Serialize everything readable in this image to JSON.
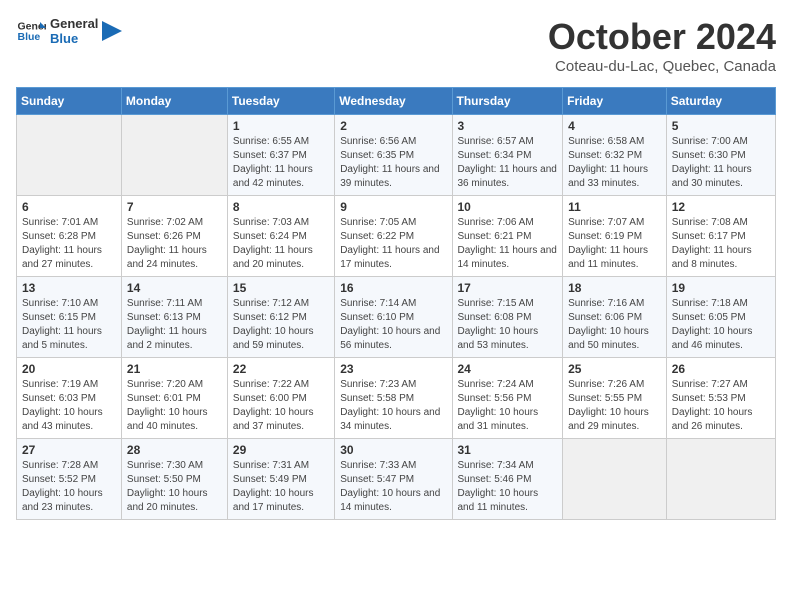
{
  "header": {
    "logo_line1": "General",
    "logo_line2": "Blue",
    "month_title": "October 2024",
    "subtitle": "Coteau-du-Lac, Quebec, Canada"
  },
  "calendar": {
    "days_of_week": [
      "Sunday",
      "Monday",
      "Tuesday",
      "Wednesday",
      "Thursday",
      "Friday",
      "Saturday"
    ],
    "weeks": [
      [
        {
          "day": "",
          "info": ""
        },
        {
          "day": "",
          "info": ""
        },
        {
          "day": "1",
          "info": "Sunrise: 6:55 AM\nSunset: 6:37 PM\nDaylight: 11 hours and 42 minutes."
        },
        {
          "day": "2",
          "info": "Sunrise: 6:56 AM\nSunset: 6:35 PM\nDaylight: 11 hours and 39 minutes."
        },
        {
          "day": "3",
          "info": "Sunrise: 6:57 AM\nSunset: 6:34 PM\nDaylight: 11 hours and 36 minutes."
        },
        {
          "day": "4",
          "info": "Sunrise: 6:58 AM\nSunset: 6:32 PM\nDaylight: 11 hours and 33 minutes."
        },
        {
          "day": "5",
          "info": "Sunrise: 7:00 AM\nSunset: 6:30 PM\nDaylight: 11 hours and 30 minutes."
        }
      ],
      [
        {
          "day": "6",
          "info": "Sunrise: 7:01 AM\nSunset: 6:28 PM\nDaylight: 11 hours and 27 minutes."
        },
        {
          "day": "7",
          "info": "Sunrise: 7:02 AM\nSunset: 6:26 PM\nDaylight: 11 hours and 24 minutes."
        },
        {
          "day": "8",
          "info": "Sunrise: 7:03 AM\nSunset: 6:24 PM\nDaylight: 11 hours and 20 minutes."
        },
        {
          "day": "9",
          "info": "Sunrise: 7:05 AM\nSunset: 6:22 PM\nDaylight: 11 hours and 17 minutes."
        },
        {
          "day": "10",
          "info": "Sunrise: 7:06 AM\nSunset: 6:21 PM\nDaylight: 11 hours and 14 minutes."
        },
        {
          "day": "11",
          "info": "Sunrise: 7:07 AM\nSunset: 6:19 PM\nDaylight: 11 hours and 11 minutes."
        },
        {
          "day": "12",
          "info": "Sunrise: 7:08 AM\nSunset: 6:17 PM\nDaylight: 11 hours and 8 minutes."
        }
      ],
      [
        {
          "day": "13",
          "info": "Sunrise: 7:10 AM\nSunset: 6:15 PM\nDaylight: 11 hours and 5 minutes."
        },
        {
          "day": "14",
          "info": "Sunrise: 7:11 AM\nSunset: 6:13 PM\nDaylight: 11 hours and 2 minutes."
        },
        {
          "day": "15",
          "info": "Sunrise: 7:12 AM\nSunset: 6:12 PM\nDaylight: 10 hours and 59 minutes."
        },
        {
          "day": "16",
          "info": "Sunrise: 7:14 AM\nSunset: 6:10 PM\nDaylight: 10 hours and 56 minutes."
        },
        {
          "day": "17",
          "info": "Sunrise: 7:15 AM\nSunset: 6:08 PM\nDaylight: 10 hours and 53 minutes."
        },
        {
          "day": "18",
          "info": "Sunrise: 7:16 AM\nSunset: 6:06 PM\nDaylight: 10 hours and 50 minutes."
        },
        {
          "day": "19",
          "info": "Sunrise: 7:18 AM\nSunset: 6:05 PM\nDaylight: 10 hours and 46 minutes."
        }
      ],
      [
        {
          "day": "20",
          "info": "Sunrise: 7:19 AM\nSunset: 6:03 PM\nDaylight: 10 hours and 43 minutes."
        },
        {
          "day": "21",
          "info": "Sunrise: 7:20 AM\nSunset: 6:01 PM\nDaylight: 10 hours and 40 minutes."
        },
        {
          "day": "22",
          "info": "Sunrise: 7:22 AM\nSunset: 6:00 PM\nDaylight: 10 hours and 37 minutes."
        },
        {
          "day": "23",
          "info": "Sunrise: 7:23 AM\nSunset: 5:58 PM\nDaylight: 10 hours and 34 minutes."
        },
        {
          "day": "24",
          "info": "Sunrise: 7:24 AM\nSunset: 5:56 PM\nDaylight: 10 hours and 31 minutes."
        },
        {
          "day": "25",
          "info": "Sunrise: 7:26 AM\nSunset: 5:55 PM\nDaylight: 10 hours and 29 minutes."
        },
        {
          "day": "26",
          "info": "Sunrise: 7:27 AM\nSunset: 5:53 PM\nDaylight: 10 hours and 26 minutes."
        }
      ],
      [
        {
          "day": "27",
          "info": "Sunrise: 7:28 AM\nSunset: 5:52 PM\nDaylight: 10 hours and 23 minutes."
        },
        {
          "day": "28",
          "info": "Sunrise: 7:30 AM\nSunset: 5:50 PM\nDaylight: 10 hours and 20 minutes."
        },
        {
          "day": "29",
          "info": "Sunrise: 7:31 AM\nSunset: 5:49 PM\nDaylight: 10 hours and 17 minutes."
        },
        {
          "day": "30",
          "info": "Sunrise: 7:33 AM\nSunset: 5:47 PM\nDaylight: 10 hours and 14 minutes."
        },
        {
          "day": "31",
          "info": "Sunrise: 7:34 AM\nSunset: 5:46 PM\nDaylight: 10 hours and 11 minutes."
        },
        {
          "day": "",
          "info": ""
        },
        {
          "day": "",
          "info": ""
        }
      ]
    ]
  }
}
